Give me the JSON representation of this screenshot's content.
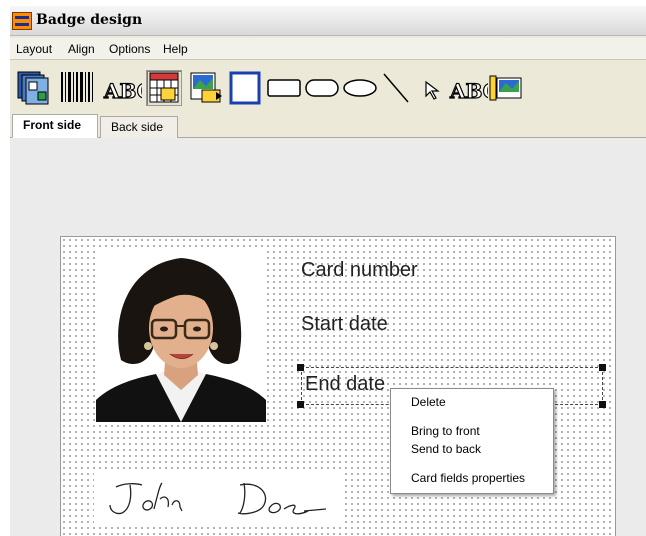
{
  "window": {
    "title": "Badge design"
  },
  "menu": [
    "Layout",
    "Align",
    "Options",
    "Help"
  ],
  "toolbar": {
    "icons": [
      "card-stack-icon",
      "barcode-icon",
      "text-field-icon",
      "date-field-icon",
      "image-field-icon",
      "rectangle-icon",
      "rounded-rectangle-icon",
      "wide-rounded-rectangle-icon",
      "ellipse-icon",
      "line-icon",
      "pointer-icon",
      "static-text-icon",
      "background-image-icon"
    ],
    "text_icon_label": "ABC",
    "pressed_tool": "date-field-icon"
  },
  "tabs": [
    {
      "label": "Front side",
      "active": true
    },
    {
      "label": "Back side",
      "active": false
    }
  ],
  "card": {
    "fields": [
      "Card number",
      "Start date",
      "End date"
    ],
    "signature": "John Doe",
    "selected_field": "End date"
  },
  "context_menu": {
    "items": [
      "Delete",
      "Bring to front",
      "Send to back",
      "Card fields properties"
    ]
  },
  "colors": {
    "workspace": "#ebebeb",
    "window_chrome": "#ece9d8",
    "toolbar_blue": "#1a3fae",
    "app_icon_orange": "#ff8c00"
  }
}
